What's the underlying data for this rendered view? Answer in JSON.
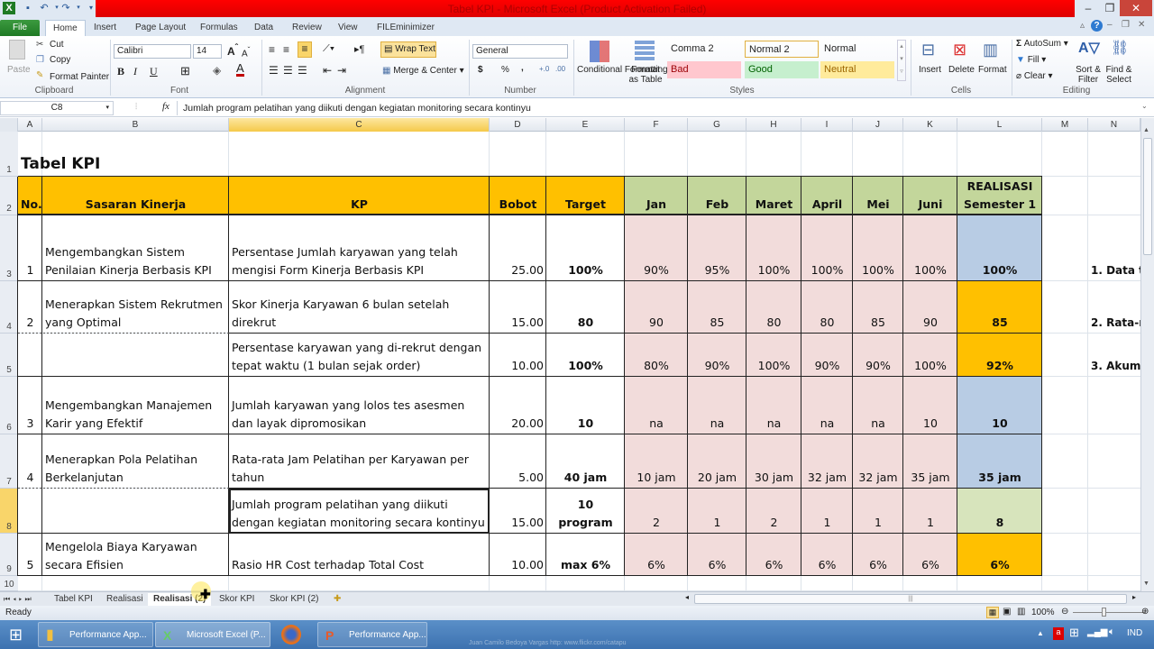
{
  "window": {
    "title": "Tabel KPI - Microsoft Excel (Product Activation Failed)",
    "minimize": "–",
    "restore": "❐",
    "close": "✕"
  },
  "ribbon_tabs": [
    "File",
    "Home",
    "Insert",
    "Page Layout",
    "Formulas",
    "Data",
    "Review",
    "View",
    "FILEminimizer"
  ],
  "ribbon": {
    "clipboard": {
      "label": "Clipboard",
      "paste": "Paste",
      "cut": "Cut",
      "copy": "Copy",
      "format_painter": "Format Painter"
    },
    "font": {
      "label": "Font",
      "name": "Calibri",
      "size": "14",
      "bold": "B",
      "italic": "I",
      "underline": "U"
    },
    "alignment": {
      "label": "Alignment",
      "wrap_text": "Wrap Text",
      "merge_center": "Merge & Center"
    },
    "number": {
      "label": "Number",
      "format": "General",
      "currency": "$",
      "percent": "%",
      "comma": ","
    },
    "styles": {
      "label": "Styles",
      "conditional_formatting": "Conditional Formatting",
      "format_as_table": "Format as Table",
      "gallery": [
        {
          "name": "Comma 2",
          "bg": "#ffffff",
          "fg": "#222222"
        },
        {
          "name": "Normal 2",
          "bg": "#ffffff",
          "fg": "#222222"
        },
        {
          "name": "Normal",
          "bg": "#ffffff",
          "fg": "#222222"
        },
        {
          "name": "Bad",
          "bg": "#ffc7ce",
          "fg": "#9c0006"
        },
        {
          "name": "Good",
          "bg": "#c6efce",
          "fg": "#006100"
        },
        {
          "name": "Neutral",
          "bg": "#ffeb9c",
          "fg": "#9c6500"
        }
      ]
    },
    "cells": {
      "label": "Cells",
      "insert": "Insert",
      "delete": "Delete",
      "format": "Format"
    },
    "editing": {
      "label": "Editing",
      "autosum": "AutoSum",
      "fill": "Fill",
      "clear": "Clear",
      "sort_filter": "Sort & Filter",
      "find_select": "Find & Select"
    }
  },
  "formula_bar": {
    "name_box": "C8",
    "fx": "fx",
    "formula": "Jumlah program pelatihan yang diikuti dengan kegiatan monitoring secara kontinyu"
  },
  "columns": [
    "A",
    "B",
    "C",
    "D",
    "E",
    "F",
    "G",
    "H",
    "I",
    "J",
    "K",
    "L",
    "M",
    "N"
  ],
  "selected_column": "C",
  "selected_row": "8",
  "rows": [
    "1",
    "2",
    "3",
    "4",
    "5",
    "6",
    "7",
    "8",
    "9",
    "10"
  ],
  "sheet": {
    "title": "Tabel KPI",
    "headers": {
      "no": "No.",
      "sasaran": "Sasaran Kinerja",
      "kp": "KP",
      "bobot": "Bobot",
      "target": "Target",
      "months": [
        "Jan",
        "Feb",
        "Maret",
        "April",
        "Mei",
        "Juni"
      ],
      "realisasi_line1": "REALISASI",
      "realisasi_line2": "Semester 1"
    },
    "records": [
      {
        "no": "1",
        "sasaran": "Mengembangkan Sistem Penilaian Kinerja Berbasis KPI",
        "kp": "Persentase Jumlah karyawan yang telah mengisi Form Kinerja Berbasis KPI",
        "bobot": "25.00",
        "target": "100%",
        "months": [
          "90%",
          "95%",
          "100%",
          "100%",
          "100%",
          "100%"
        ],
        "realisasi": "100%",
        "realisasi_color": "#b8cce4"
      },
      {
        "no": "2",
        "sasaran": "Menerapkan Sistem Rekrutmen yang Optimal",
        "kp": "Skor Kinerja Karyawan 6 bulan setelah direkrut",
        "bobot": "15.00",
        "target": "80",
        "months": [
          "90",
          "85",
          "80",
          "80",
          "85",
          "90"
        ],
        "realisasi": "85",
        "realisasi_color": "#ffc000"
      },
      {
        "no": "",
        "sasaran": "",
        "kp": "Persentase karyawan yang di-rekrut dengan tepat waktu (1 bulan sejak order)",
        "bobot": "10.00",
        "target": "100%",
        "months": [
          "80%",
          "90%",
          "100%",
          "90%",
          "90%",
          "100%"
        ],
        "realisasi": "92%",
        "realisasi_color": "#ffc000"
      },
      {
        "no": "3",
        "sasaran": "Mengembangkan Manajemen Karir yang Efektif",
        "kp": "Jumlah karyawan yang lolos tes asesmen dan layak dipromosikan",
        "bobot": "20.00",
        "target": "10",
        "months": [
          "na",
          "na",
          "na",
          "na",
          "na",
          "10"
        ],
        "realisasi": "10",
        "realisasi_color": "#b8cce4"
      },
      {
        "no": "4",
        "sasaran": "Menerapkan Pola Pelatihan Berkelanjutan",
        "kp": "Rata-rata Jam Pelatihan per Karyawan per tahun",
        "bobot": "5.00",
        "target": "40 jam",
        "months": [
          "10 jam",
          "20 jam",
          "30 jam",
          "32 jam",
          "32 jam",
          "35 jam"
        ],
        "realisasi": "35 jam",
        "realisasi_color": "#b8cce4"
      },
      {
        "no": "",
        "sasaran": "",
        "kp": "Jumlah program pelatihan yang diikuti dengan kegiatan monitoring secara kontinyu",
        "bobot": "15.00",
        "target": "10 program",
        "months": [
          "2",
          "1",
          "2",
          "1",
          "1",
          "1"
        ],
        "realisasi": "8",
        "realisasi_color": "#d7e4bc"
      },
      {
        "no": "5",
        "sasaran": "Mengelola Biaya Karyawan secara Efisien",
        "kp": "Rasio HR Cost terhadap Total Cost",
        "bobot": "10.00",
        "target": "max 6%",
        "months": [
          "6%",
          "6%",
          "6%",
          "6%",
          "6%",
          "6%"
        ],
        "realisasi": "6%",
        "realisasi_color": "#ffc000"
      }
    ],
    "side_notes": [
      "1. Data t",
      "2. Rata-r",
      "3. Akumu"
    ]
  },
  "colors": {
    "header_orange": "#ffc000",
    "header_green": "#c3d69b",
    "month_pink": "#f2dcdb",
    "title_red": "#e80000"
  },
  "sheet_tabs": [
    {
      "name": "Tabel KPI",
      "active": false
    },
    {
      "name": "Realisasi",
      "active": false
    },
    {
      "name": "Realisasi (2)",
      "active": true
    },
    {
      "name": "Skor KPI",
      "active": false
    },
    {
      "name": "Skor KPI (2)",
      "active": false
    }
  ],
  "status": {
    "ready": "Ready",
    "zoom": "100%"
  },
  "taskbar": {
    "items": [
      "Performance App...",
      "Microsoft Excel (P...",
      "",
      "Performance App..."
    ],
    "watermark": "Juan Camilo Bedoya Vargas  http: www.flickr.com/catapu",
    "lang": "IND"
  }
}
